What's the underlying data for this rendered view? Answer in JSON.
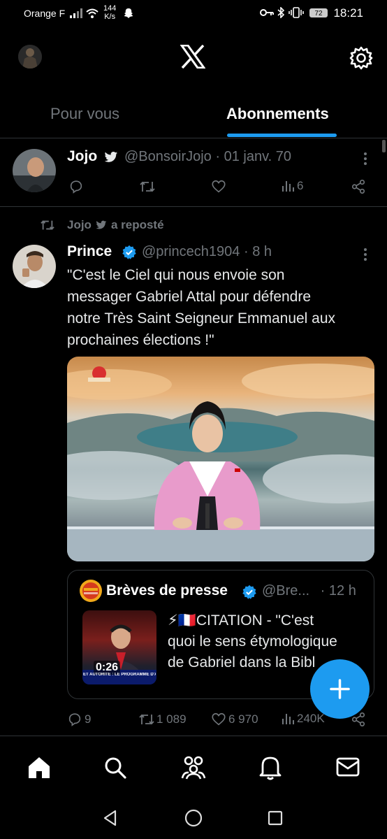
{
  "status_bar": {
    "carrier": "Orange F",
    "speed_value": "144",
    "speed_unit": "K/s",
    "battery": "72",
    "time": "18:21"
  },
  "header": {
    "logo": "X",
    "settings_icon": "gear-icon"
  },
  "tabs": [
    {
      "label": "Pour vous",
      "active": false
    },
    {
      "label": "Abonnements",
      "active": true
    }
  ],
  "tweet1": {
    "name": "Jojo",
    "handle": "@BonsoirJojo",
    "sep": "·",
    "date": "01 janv. 70",
    "views": "6"
  },
  "repost": {
    "name": "Jojo",
    "label": "a reposté"
  },
  "tweet2": {
    "name": "Prince",
    "handle": "@princech1904",
    "sep": "·",
    "time": "8 h",
    "text": "\"C'est le Ciel qui nous envoie son\nmessager Gabriel Attal pour défendre\nnotre Très Saint Seigneur Emmanuel aux\nprochaines élections !\"",
    "replies": "9",
    "reposts": "1 089",
    "likes": "6 970",
    "views": "240K"
  },
  "quote": {
    "name": "Brèves de presse",
    "handle": "@Bre...",
    "sep": "·",
    "time": "12 h",
    "text": "⚡🇫🇷CITATION - \"C'est\nquoi le sens étymologique\nde Gabriel dans la Bibl",
    "video_duration": "0:26",
    "thumb_caption": "ET AUTORITÉ : LE PROGRAMME D'ATTAL?"
  },
  "colors": {
    "accent": "#1d9bf0",
    "verified": "#1d9bf0",
    "muted": "#71767b"
  }
}
